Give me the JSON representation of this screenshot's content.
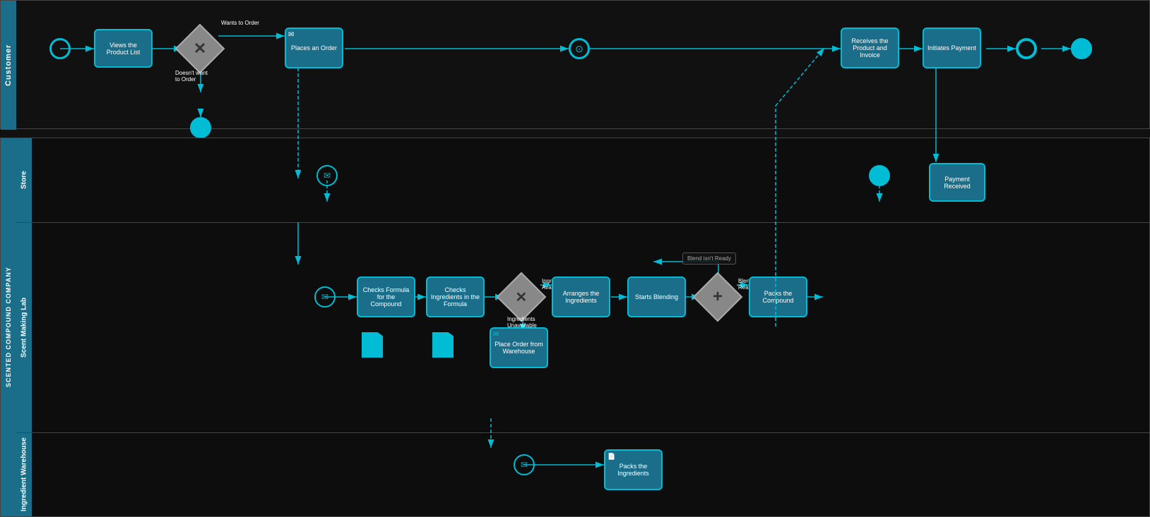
{
  "pools": {
    "customer": {
      "label": "Customer",
      "lanes": []
    },
    "scc": {
      "label": "SCENTED COMPOUND COMPANY",
      "lanes": [
        {
          "id": "store",
          "label": "Store"
        },
        {
          "id": "scent-making-lab",
          "label": "Scent Making Lab"
        },
        {
          "id": "ingredient-warehouse",
          "label": "Ingredient Warehouse"
        }
      ]
    }
  },
  "elements": {
    "customer_start": {
      "label": ""
    },
    "views_product_list": {
      "label": "Views the Product List"
    },
    "wants_to_order": {
      "label": "Wants to Order"
    },
    "doesnt_want_to_order": {
      "label": "Doesn't want to Order"
    },
    "places_an_order": {
      "label": "Places an Order"
    },
    "receives_product_invoice": {
      "label": "Receives the Product and Invoice"
    },
    "initiates_payment": {
      "label": "Initiates Payment"
    },
    "payment_received": {
      "label": "Payment Received"
    },
    "checks_formula": {
      "label": "Checks Formula for the Compound"
    },
    "checks_ingredients_formula": {
      "label": "Checks Ingredients in the Formula"
    },
    "ingredients_available": {
      "label": "Ingredients Available"
    },
    "ingredients_unavailable": {
      "label": "Ingredients Unavailable"
    },
    "arranges_ingredients": {
      "label": "Arranges the Ingredients"
    },
    "starts_blending": {
      "label": "Starts Blending"
    },
    "blend_is_ready": {
      "label": "Blend is Ready"
    },
    "blend_isnt_ready": {
      "label": "Blend isn't Ready"
    },
    "packs_the_compound": {
      "label": "Packs the Compound"
    },
    "place_order_warehouse": {
      "label": "Place Order from Warehouse"
    },
    "packs_ingredients": {
      "label": "Packs the Ingredients"
    }
  },
  "colors": {
    "primary": "#00bcd4",
    "lane_bg": "#1a6e8a",
    "task_bg": "#1a6e8a",
    "gateway_bg": "#888888",
    "dark_bg": "#111111",
    "connection": "#00bcd4"
  }
}
